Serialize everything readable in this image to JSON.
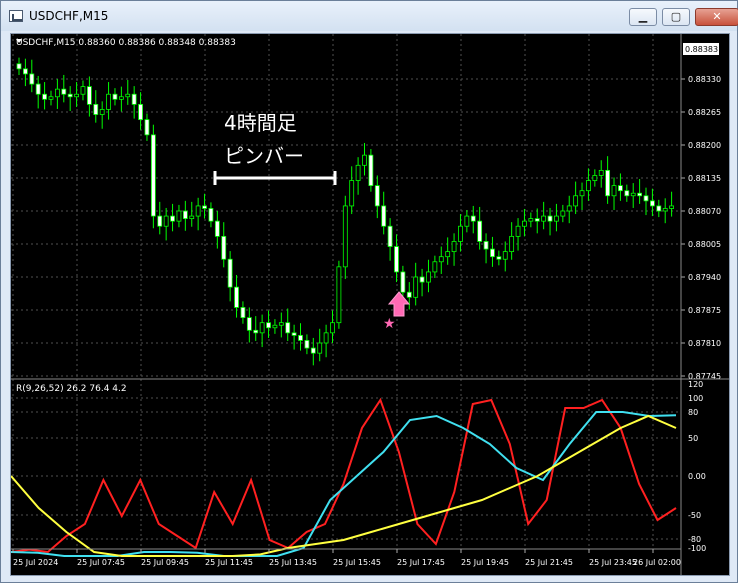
{
  "window": {
    "title": "USDCHF,M15",
    "buttons": {
      "minimize": "▁",
      "maximize": "▢",
      "close": "✕"
    }
  },
  "main_chart": {
    "header": "USDCHF,M15  0.88360 0.88386 0.88348 0.88383",
    "current_price": "0.88383",
    "price_ticks": [
      "0.88330",
      "0.88265",
      "0.88200",
      "0.88135",
      "0.88070",
      "0.88005",
      "0.87940",
      "0.87875",
      "0.87810",
      "0.87745"
    ],
    "annotation_line1": "4時間足",
    "annotation_line2": "ピンバー",
    "colors": {
      "bull": "#00ff00",
      "bear": "#00ff00",
      "bull_body": "#000000",
      "bear_body": "#ffffff",
      "grid": "#4a4a4a",
      "arrow": "#ff69b4",
      "star": "#ff69b4"
    }
  },
  "indicator": {
    "label": "R(9,26,52) 26.2 76.4 4.2",
    "ticks": [
      "120",
      "100",
      "80",
      "50",
      "0.00",
      "-50",
      "-80",
      "-100"
    ],
    "colors": {
      "red": "#ff2020",
      "cyan": "#40e0f0",
      "yellow": "#ffff40"
    }
  },
  "time_axis": [
    "25 Jul 2024",
    "25 Jul 07:45",
    "25 Jul 09:45",
    "25 Jul 11:45",
    "25 Jul 13:45",
    "25 Jul 15:45",
    "25 Jul 17:45",
    "25 Jul 19:45",
    "25 Jul 21:45",
    "25 Jul 23:45",
    "26 Jul 02:00"
  ],
  "chart_data": [
    {
      "type": "candlestick",
      "title": "USDCHF,M15",
      "ylim": [
        0.87745,
        0.88383
      ],
      "series": [
        {
          "name": "USDCHF,M15",
          "values": [
            0.8836,
            0.88386,
            0.88348,
            0.88383
          ]
        }
      ]
    },
    {
      "type": "line",
      "title": "R(9,26,52) 26.2 76.4 4.2",
      "ylim": [
        -100,
        120
      ],
      "series": [
        {
          "name": "R(9,26,52) 26.2",
          "values": [
            -95,
            -92,
            -95,
            -75,
            -60,
            -5,
            -50,
            -5,
            -60,
            -75,
            -90,
            -20,
            -60,
            -5,
            -80,
            -90,
            -70,
            -60,
            -10,
            60,
            95,
            30,
            -60,
            -85,
            -20,
            90,
            95,
            40,
            -60,
            -30,
            85,
            85,
            95,
            60,
            -10,
            -55,
            -40
          ]
        },
        {
          "name": "R(9,26,52) 76.4",
          "values": [
            -95,
            -96,
            -100,
            -100,
            -100,
            -95,
            -95,
            -96,
            -100,
            -100,
            -100,
            -90,
            -30,
            0,
            30,
            70,
            75,
            60,
            40,
            10,
            -5,
            40,
            80,
            80,
            75,
            76
          ]
        },
        {
          "name": "R(9,26,52) 4.2",
          "values": [
            0,
            -40,
            -70,
            -95,
            -100,
            -100,
            -100,
            -100,
            -100,
            -98,
            -90,
            -85,
            -80,
            -70,
            -60,
            -50,
            -40,
            -30,
            -15,
            0,
            20,
            40,
            60,
            75,
            60
          ]
        }
      ]
    }
  ]
}
